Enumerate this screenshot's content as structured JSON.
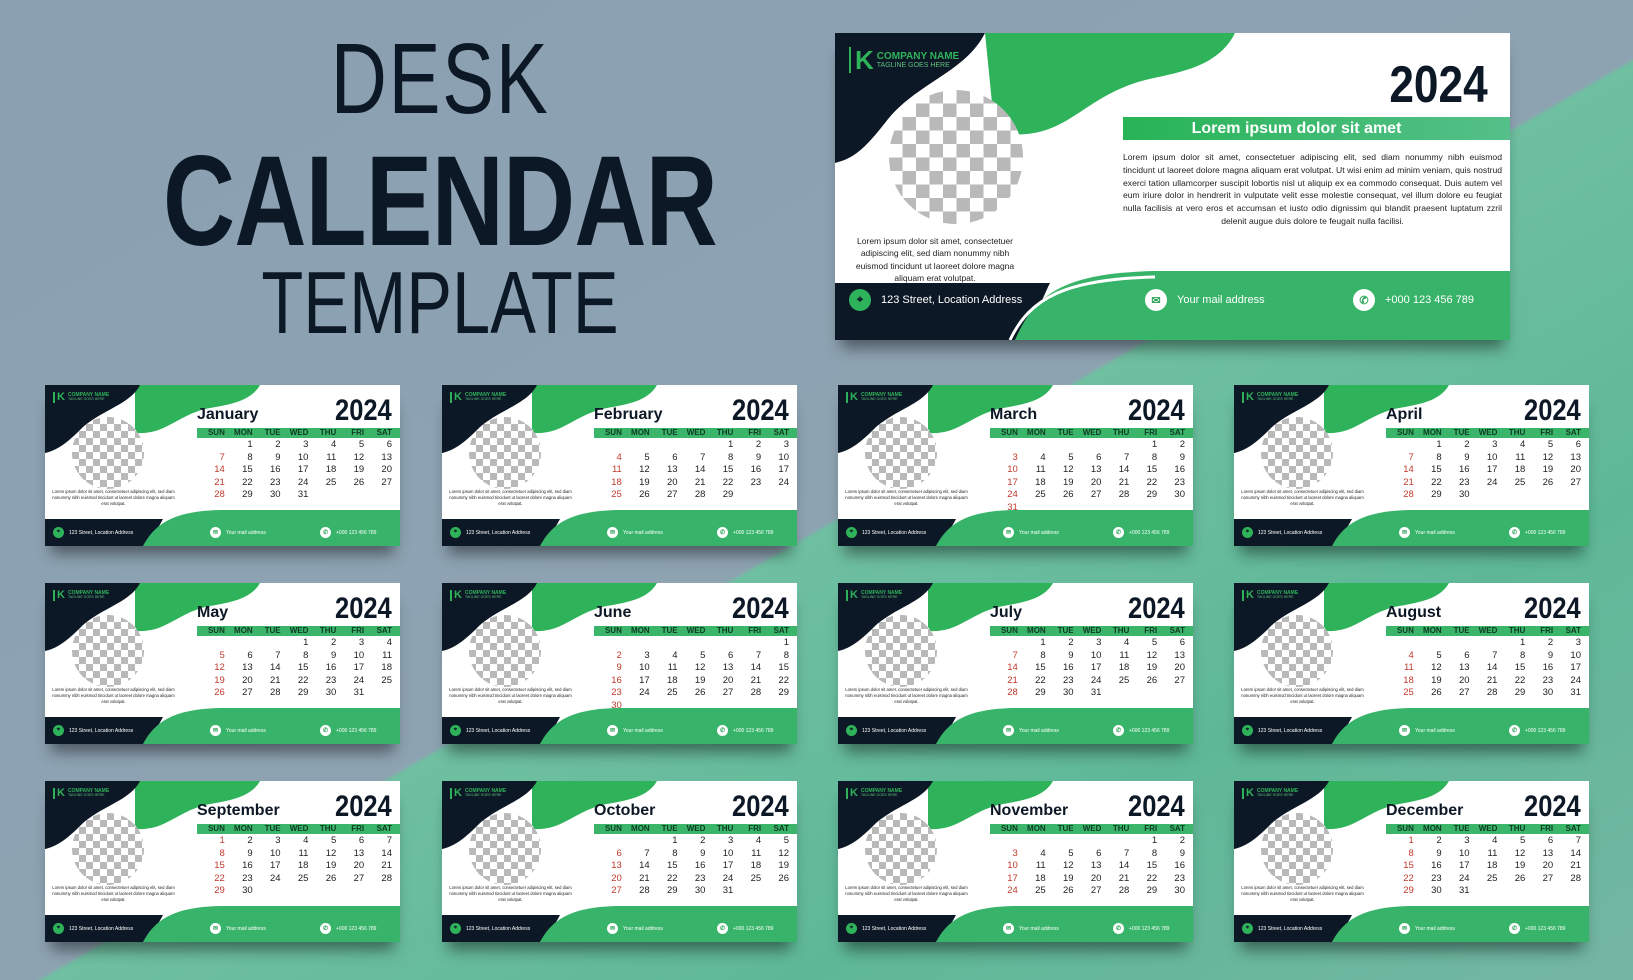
{
  "heading": {
    "line1": "DESK",
    "line2": "CALENDAR",
    "line3": "TEMPLATE"
  },
  "colors": {
    "navy": "#0d1826",
    "green": "#2fb35a",
    "light_green": "#5ec394",
    "sunday": "#c0392b",
    "background": "#8aa0b1"
  },
  "company": {
    "logo_letter": "K",
    "name": "COMPANY NAME",
    "tagline": "TAGLINE GOES HERE"
  },
  "year": "2024",
  "cover": {
    "heading": "Lorem ipsum dolor sit amet",
    "body": "Lorem ipsum dolor sit amet, consectetuer adipiscing elit, sed diam nonummy nibh euismod tincidunt ut laoreet dolore magna aliquam erat volutpat. Ut wisi enim ad minim veniam, quis nostrud exerci tation ullamcorper suscipit lobortis nisl ut aliquip ex ea commodo consequat. Duis autem vel eum iriure dolor in hendrerit in vulputate velit esse molestie consequat, vel illum dolore eu feugiat nulla facilisis at vero eros et accumsan et iusto odio dignissim qui blandit praesent luptatum zzril delenit augue duis dolore te feugait nulla facilisi.",
    "side_text": "Lorem ipsum dolor sit amet, consectetuer adipiscing elit, sed diam nonummy nibh euismod tincidunt ut laoreet dolore magna aliquam erat volutpat.",
    "image_placeholder": "checkerboard"
  },
  "footer": {
    "address": "123 Street, Location Address",
    "email": "Your mail address",
    "phone": "+000 123 456 789",
    "icons": [
      "location-pin-icon",
      "mail-icon",
      "phone-icon"
    ]
  },
  "weekdays": [
    "SUN",
    "MON",
    "TUE",
    "WED",
    "THU",
    "FRI",
    "SAT"
  ],
  "months": [
    {
      "name": "January",
      "first_weekday": 1,
      "days": 31
    },
    {
      "name": "February",
      "first_weekday": 4,
      "days": 29
    },
    {
      "name": "March",
      "first_weekday": 5,
      "days": 31
    },
    {
      "name": "April",
      "first_weekday": 1,
      "days": 30
    },
    {
      "name": "May",
      "first_weekday": 3,
      "days": 31
    },
    {
      "name": "June",
      "first_weekday": 6,
      "days": 30
    },
    {
      "name": "July",
      "first_weekday": 1,
      "days": 31
    },
    {
      "name": "August",
      "first_weekday": 4,
      "days": 31
    },
    {
      "name": "September",
      "first_weekday": 0,
      "days": 30
    },
    {
      "name": "October",
      "first_weekday": 2,
      "days": 31
    },
    {
      "name": "November",
      "first_weekday": 5,
      "days": 30
    },
    {
      "name": "December",
      "first_weekday": 0,
      "days": 31
    }
  ]
}
